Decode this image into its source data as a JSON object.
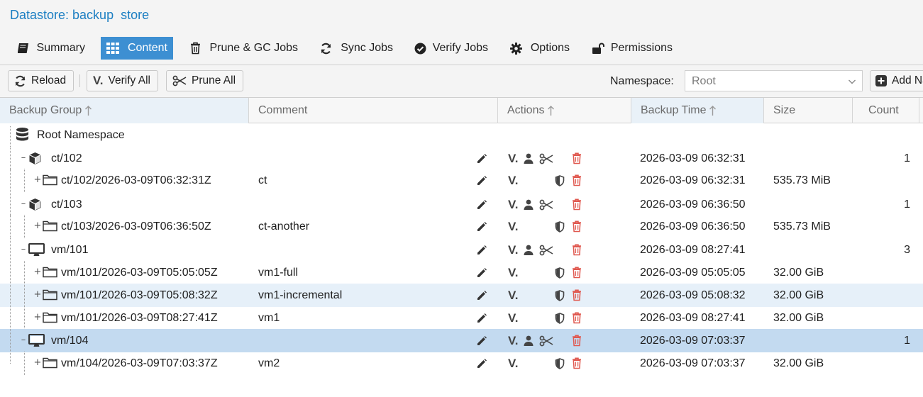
{
  "header": {
    "title": "Datastore: backup  store"
  },
  "tabs": [
    {
      "label": "Summary",
      "icon": "book-icon",
      "active": false
    },
    {
      "label": "Content",
      "icon": "grid-icon",
      "active": true
    },
    {
      "label": "Prune & GC Jobs",
      "icon": "trash-icon",
      "active": false
    },
    {
      "label": "Sync Jobs",
      "icon": "refresh-icon",
      "active": false
    },
    {
      "label": "Verify Jobs",
      "icon": "check-circle-icon",
      "active": false
    },
    {
      "label": "Options",
      "icon": "gear-icon",
      "active": false
    },
    {
      "label": "Permissions",
      "icon": "unlock-icon",
      "active": false
    }
  ],
  "toolbar": {
    "reload_label": "Reload",
    "verify_all_label": "Verify All",
    "prune_all_label": "Prune All",
    "namespace_label": "Namespace:",
    "namespace_value": "Root",
    "add_namespace_label": "Add Namespace"
  },
  "columns": {
    "backup_group": "Backup Group",
    "comment": "Comment",
    "actions": "Actions",
    "backup_time": "Backup Time",
    "size": "Size",
    "count": "Count"
  },
  "root": {
    "label": "Root Namespace"
  },
  "rows": [
    {
      "kind": "group",
      "type": "ct",
      "name": "ct/102",
      "comment": "",
      "time": "2026-03-09 06:32:31",
      "size": "",
      "count": "1",
      "state": ""
    },
    {
      "kind": "snapshot",
      "type": "ct",
      "name": "ct/102/2026-03-09T06:32:31Z",
      "comment": "ct",
      "time": "2026-03-09 06:32:31",
      "size": "535.73 MiB",
      "count": "",
      "state": ""
    },
    {
      "kind": "group",
      "type": "ct",
      "name": "ct/103",
      "comment": "",
      "time": "2026-03-09 06:36:50",
      "size": "",
      "count": "1",
      "state": ""
    },
    {
      "kind": "snapshot",
      "type": "ct",
      "name": "ct/103/2026-03-09T06:36:50Z",
      "comment": "ct-another",
      "time": "2026-03-09 06:36:50",
      "size": "535.73 MiB",
      "count": "",
      "state": ""
    },
    {
      "kind": "group",
      "type": "vm",
      "name": "vm/101",
      "comment": "",
      "time": "2026-03-09 08:27:41",
      "size": "",
      "count": "3",
      "state": ""
    },
    {
      "kind": "snapshot",
      "type": "vm",
      "name": "vm/101/2026-03-09T05:05:05Z",
      "comment": "vm1-full",
      "time": "2026-03-09 05:05:05",
      "size": "32.00 GiB",
      "count": "",
      "state": ""
    },
    {
      "kind": "snapshot",
      "type": "vm",
      "name": "vm/101/2026-03-09T05:08:32Z",
      "comment": "vm1-incremental",
      "time": "2026-03-09 05:08:32",
      "size": "32.00 GiB",
      "count": "",
      "state": "hover"
    },
    {
      "kind": "snapshot",
      "type": "vm",
      "name": "vm/101/2026-03-09T08:27:41Z",
      "comment": "vm1",
      "time": "2026-03-09 08:27:41",
      "size": "32.00 GiB",
      "count": "",
      "state": ""
    },
    {
      "kind": "group",
      "type": "vm",
      "name": "vm/104",
      "comment": "",
      "time": "2026-03-09 07:03:37",
      "size": "",
      "count": "1",
      "state": "selected"
    },
    {
      "kind": "snapshot",
      "type": "vm",
      "name": "vm/104/2026-03-09T07:03:37Z",
      "comment": "vm2",
      "time": "2026-03-09 07:03:37",
      "size": "32.00 GiB",
      "count": "",
      "state": ""
    }
  ],
  "colors": {
    "accent": "#3d8fd2",
    "title": "#1b7ec2",
    "delete": "#e0584f",
    "selected_row": "#c3daf0",
    "hover_row": "#e6f0f9"
  }
}
